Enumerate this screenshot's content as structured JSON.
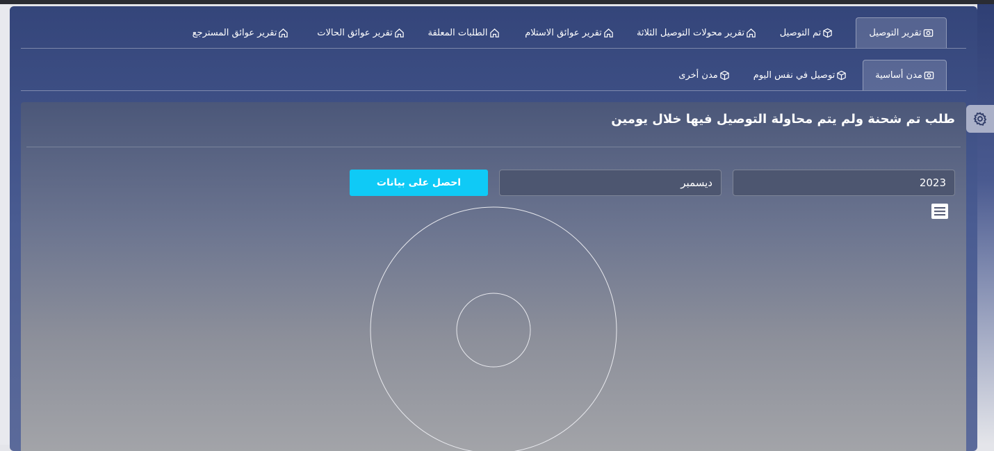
{
  "tabs_primary": [
    {
      "label": "تقرير التوصيل",
      "icon": "camera-icon",
      "active": true
    },
    {
      "label": "تم التوصيل",
      "icon": "box-icon",
      "active": false
    },
    {
      "label": "تقرير محولات التوصيل الثلاثة",
      "icon": "home-icon",
      "active": false
    },
    {
      "label": "تقرير عوائق الاستلام",
      "icon": "home-icon",
      "active": false
    },
    {
      "label": "الطلبات المعلقة",
      "icon": "home-icon",
      "active": false
    },
    {
      "label": "تقرير عوائق الحالات",
      "icon": "home-icon",
      "active": false
    },
    {
      "label": "تقرير عوائق المسترجع",
      "icon": "home-icon",
      "active": false
    }
  ],
  "tabs_secondary": [
    {
      "label": "مدن أساسية",
      "icon": "camera-icon",
      "active": true
    },
    {
      "label": "توصيل في نفس اليوم",
      "icon": "box-icon",
      "active": false
    },
    {
      "label": "مدن أخرى",
      "icon": "box-icon",
      "active": false
    }
  ],
  "card": {
    "title": "طلب تم شحنة ولم يتم محاولة التوصيل فيها خلال يومين"
  },
  "filters": {
    "year": "2023",
    "month": "ديسمبر",
    "submit_label": "احصل على بيانات"
  },
  "icons": {
    "menu": "hamburger-menu-icon",
    "settings": "gear-icon"
  },
  "colors": {
    "accent_button": "#0fcaf6",
    "panel_top": "#34457a"
  }
}
